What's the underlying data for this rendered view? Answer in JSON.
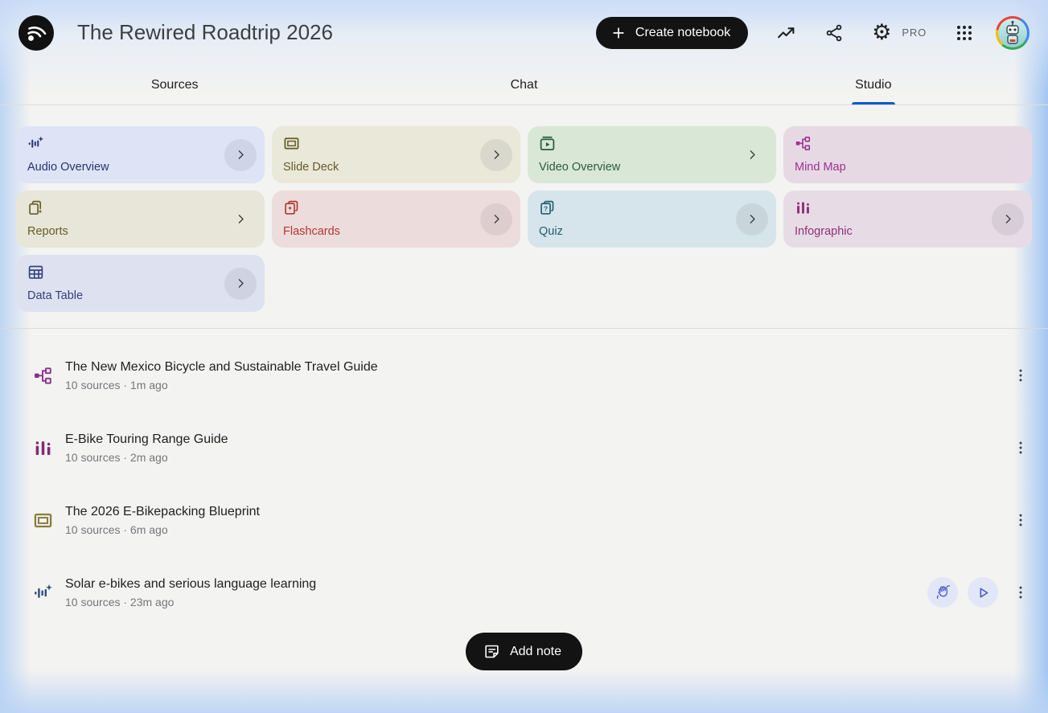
{
  "header": {
    "title": "The Rewired Roadtrip 2026",
    "create_button_label": "Create notebook",
    "pro_label": "PRO"
  },
  "tabs": [
    {
      "label": "Sources",
      "active": false
    },
    {
      "label": "Chat",
      "active": false
    },
    {
      "label": "Studio",
      "active": true
    }
  ],
  "studio_cards": [
    {
      "label": "Audio Overview",
      "color": "#28356f",
      "bg": "#dee3f6"
    },
    {
      "label": "Slide Deck",
      "color": "#635d28",
      "bg": "#e9e8d9"
    },
    {
      "label": "Video Overview",
      "color": "#2b5d3c",
      "bg": "#d9e7d7"
    },
    {
      "label": "Mind Map",
      "color": "#9c3291",
      "bg": "#e6d9e4"
    },
    {
      "label": "Reports",
      "color": "#635d28",
      "bg": "#e8e6d8"
    },
    {
      "label": "Flashcards",
      "color": "#ae3a34",
      "bg": "#eddcdc"
    },
    {
      "label": "Quiz",
      "color": "#215e72",
      "bg": "#d6e5eb"
    },
    {
      "label": "Infographic",
      "color": "#8f3277",
      "bg": "#e7dce5"
    },
    {
      "label": "Data Table",
      "color": "#33427c",
      "bg": "#dee2f0"
    }
  ],
  "items": [
    {
      "icon": "mind-map-icon",
      "title": "The New Mexico Bicycle and Sustainable Travel Guide",
      "meta": "10 sources · 1m ago"
    },
    {
      "icon": "infographic-icon",
      "title": "E-Bike Touring Range Guide",
      "meta": "10 sources · 2m ago"
    },
    {
      "icon": "slide-deck-icon",
      "title": "The 2026 E-Bikepacking Blueprint",
      "meta": "10 sources · 6m ago"
    },
    {
      "icon": "audio-overview-icon",
      "title": "Solar e-bikes and serious language learning",
      "meta": "10 sources · 23m ago"
    }
  ],
  "add_note_label": "Add note",
  "theme": {
    "active_tab_underline": "#0b57d0",
    "pill_button_bg": "#131314",
    "page_bg": "#f3f3f1",
    "edge_glow": "#9ec3ee",
    "play_button_color": "#4a57d0",
    "play_button_bg": "#e2e7f8"
  }
}
